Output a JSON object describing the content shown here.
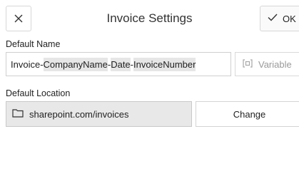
{
  "header": {
    "title": "Invoice Settings",
    "close_icon": "close-icon",
    "ok_label": "OK",
    "ok_icon": "check-icon"
  },
  "default_name": {
    "label": "Default Name",
    "parts": [
      {
        "text": "Invoice-",
        "token": false
      },
      {
        "text": "CompanyName",
        "token": true
      },
      {
        "text": "-",
        "token": false
      },
      {
        "text": "Date",
        "token": true
      },
      {
        "text": "-",
        "token": false
      },
      {
        "text": "InvoiceNumber",
        "token": true
      }
    ],
    "variable_label": "Variable",
    "variable_icon": "variable-icon"
  },
  "default_location": {
    "label": "Default Location",
    "path": "sharepoint.com/invoices",
    "folder_icon": "folder-icon",
    "change_label": "Change"
  },
  "colors": {
    "token_bg": "#e6e6e6",
    "location_bg": "#e8e8e8",
    "border": "#d7d7d7",
    "disabled_text": "#9a9a9a"
  }
}
